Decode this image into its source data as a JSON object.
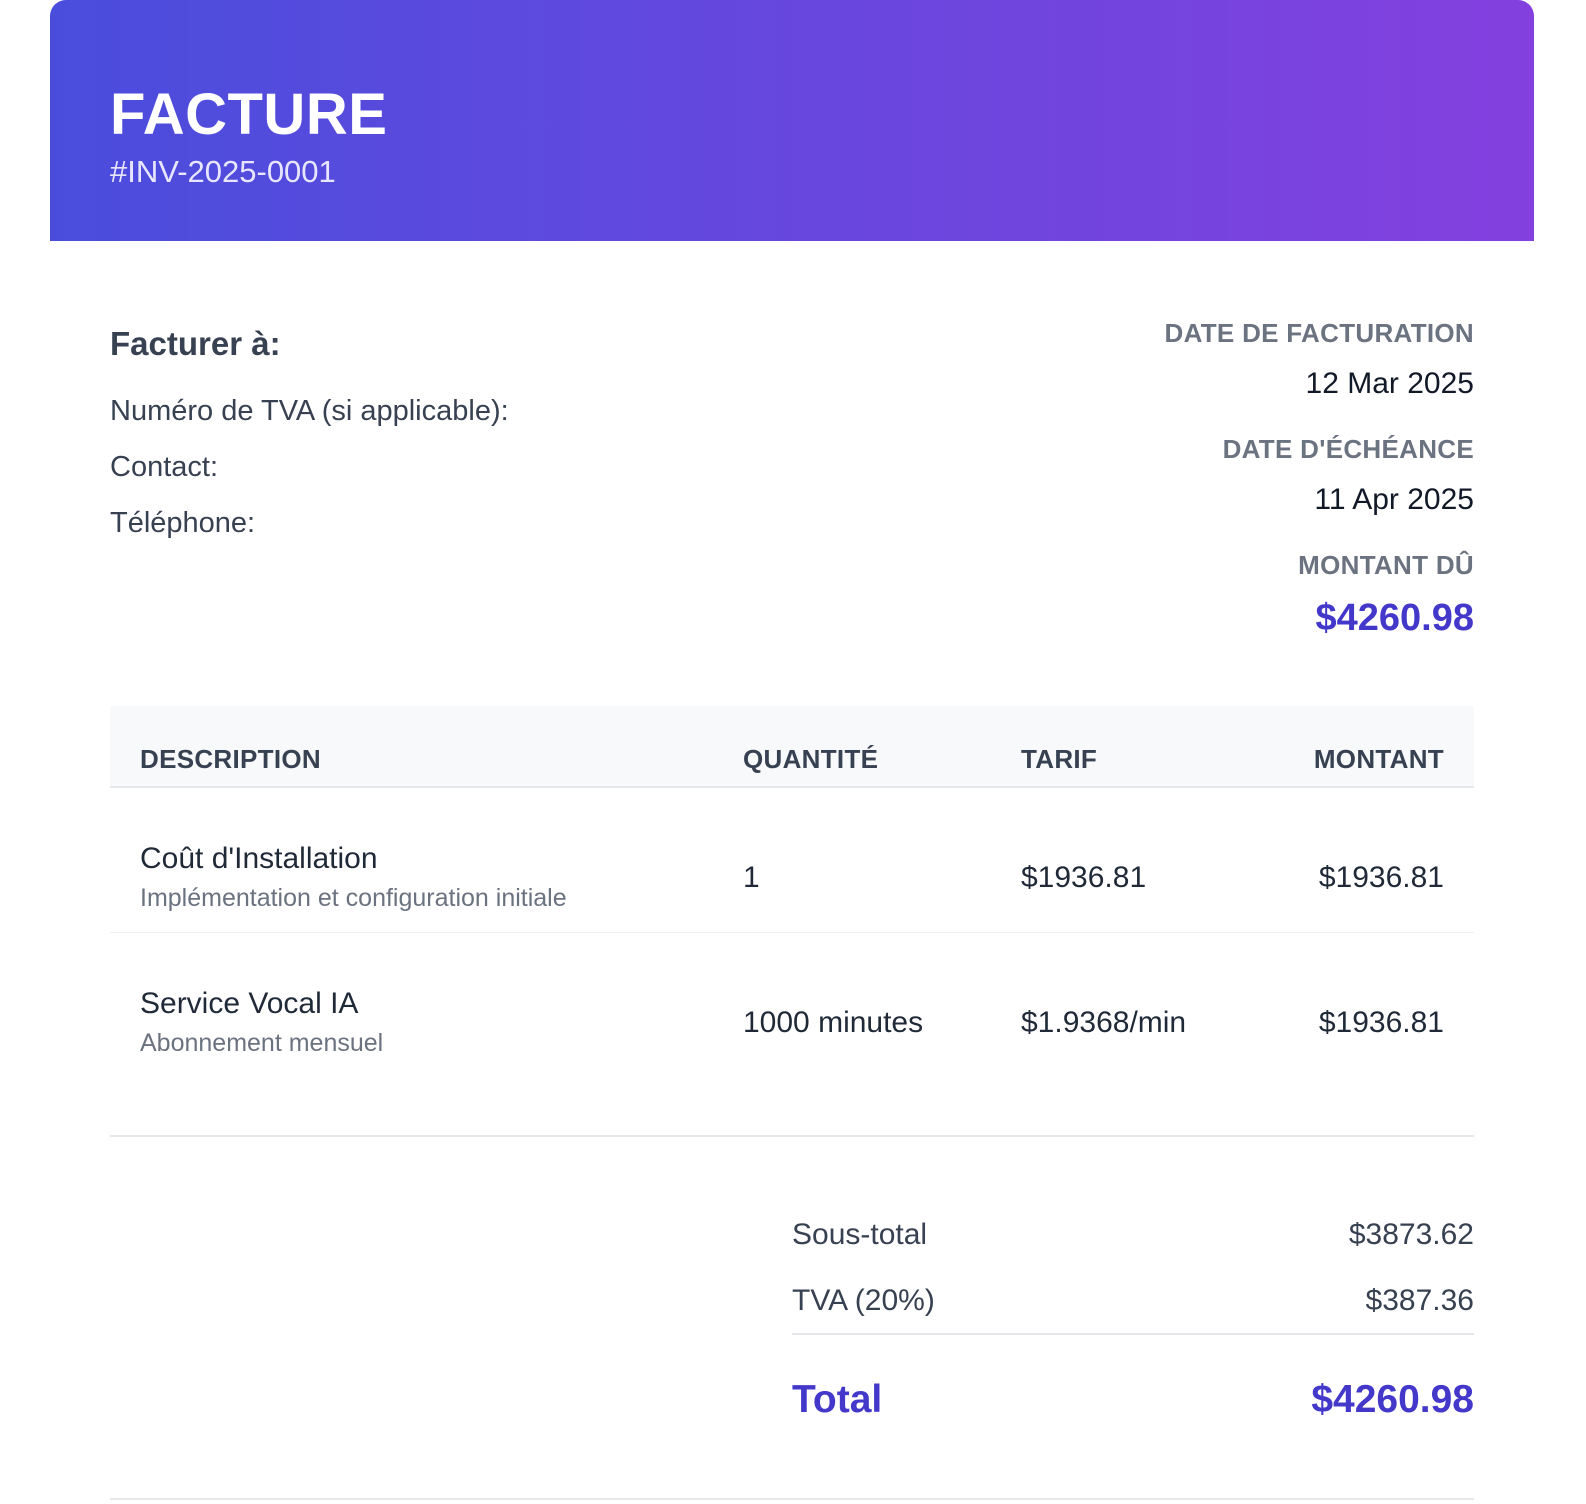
{
  "header": {
    "title": "FACTURE",
    "invoice_number": "#INV-2025-0001"
  },
  "bill_to": {
    "title": "Facturer à:",
    "vat_label": "Numéro de TVA (si applicable):",
    "contact_label": "Contact:",
    "phone_label": "Téléphone:"
  },
  "meta": {
    "invoice_date_label": "DATE DE FACTURATION",
    "invoice_date": "12 Mar 2025",
    "due_date_label": "DATE D'ÉCHÉANCE",
    "due_date": "11 Apr 2025",
    "amount_due_label": "MONTANT DÛ",
    "amount_due": "$4260.98"
  },
  "table": {
    "headers": {
      "description": "DESCRIPTION",
      "quantity": "QUANTITÉ",
      "rate": "TARIF",
      "amount": "MONTANT"
    },
    "rows": [
      {
        "title": "Coût d'Installation",
        "subtitle": "Implémentation et configuration initiale",
        "quantity": "1",
        "rate": "$1936.81",
        "amount": "$1936.81"
      },
      {
        "title": "Service Vocal IA",
        "subtitle": "Abonnement mensuel",
        "quantity": "1000 minutes",
        "rate": "$1.9368/min",
        "amount": "$1936.81"
      }
    ]
  },
  "summary": {
    "subtotal_label": "Sous-total",
    "subtotal": "$3873.62",
    "tax_label": "TVA (20%)",
    "tax": "$387.36",
    "total_label": "Total",
    "total": "$4260.98"
  },
  "colors": {
    "accent": "#4338ca",
    "header_gradient_start": "#4a4ddc",
    "header_gradient_end": "#8340df"
  }
}
